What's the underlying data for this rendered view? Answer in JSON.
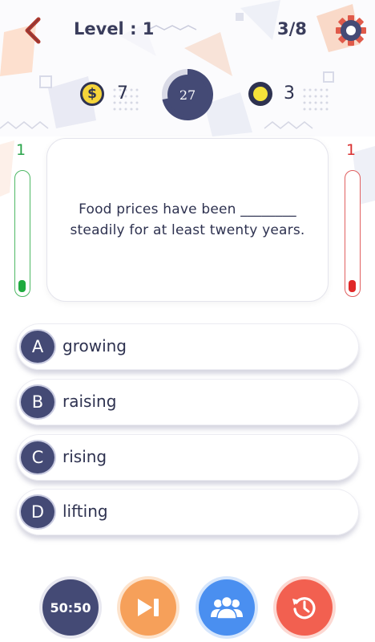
{
  "header": {
    "level_label": "Level : 1",
    "progress": "3/8",
    "back_icon": "chevron-left-icon",
    "settings_icon": "gear-icon"
  },
  "stats": {
    "dollar_symbol": "$",
    "dollar_count": "7",
    "timer": "27",
    "timer_fraction": 0.72,
    "coin_count": "3"
  },
  "scores": {
    "left": "1",
    "right": "1",
    "left_fill": 0.1,
    "right_fill": 0.1
  },
  "question": {
    "line1": "Food prices have been ________",
    "line2": "steadily for at least twenty years."
  },
  "answers": [
    {
      "letter": "A",
      "text": "growing"
    },
    {
      "letter": "B",
      "text": "raising"
    },
    {
      "letter": "C",
      "text": "rising"
    },
    {
      "letter": "D",
      "text": "lifting"
    }
  ],
  "lifelines": {
    "fifty_fifty": "50:50",
    "skip_icon": "skip-forward-icon",
    "audience_icon": "audience-icon",
    "time_icon": "time-restore-icon"
  },
  "colors": {
    "navy": "#444a75",
    "green": "#1faa3f",
    "red": "#e02828",
    "orange": "#f6a05a",
    "blue": "#4a8ff0",
    "coral": "#f26050"
  }
}
